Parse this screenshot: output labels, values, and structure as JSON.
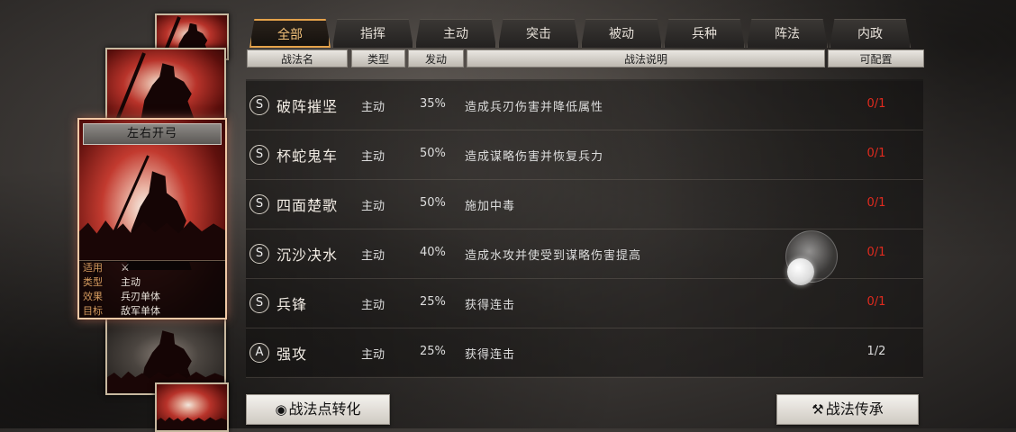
{
  "tabs": [
    {
      "label": "全部",
      "active": true
    },
    {
      "label": "指挥",
      "active": false
    },
    {
      "label": "主动",
      "active": false
    },
    {
      "label": "突击",
      "active": false
    },
    {
      "label": "被动",
      "active": false
    },
    {
      "label": "兵种",
      "active": false
    },
    {
      "label": "阵法",
      "active": false
    },
    {
      "label": "内政",
      "active": false
    }
  ],
  "table": {
    "headers": {
      "name": "战法名",
      "type": "类型",
      "rate": "发动",
      "desc": "战法说明",
      "config": "可配置"
    },
    "rows": [
      {
        "grade": "S",
        "name": "破阵摧坚",
        "type": "主动",
        "rate": "35%",
        "desc": "造成兵刃伤害并降低属性",
        "config": "0/1",
        "config_color": "#e02a1e"
      },
      {
        "grade": "S",
        "name": "杯蛇鬼车",
        "type": "主动",
        "rate": "50%",
        "desc": "造成谋略伤害并恢复兵力",
        "config": "0/1",
        "config_color": "#e02a1e"
      },
      {
        "grade": "S",
        "name": "四面楚歌",
        "type": "主动",
        "rate": "50%",
        "desc": "施加中毒",
        "config": "0/1",
        "config_color": "#e02a1e"
      },
      {
        "grade": "S",
        "name": "沉沙决水",
        "type": "主动",
        "rate": "40%",
        "desc": "造成水攻并使受到谋略伤害提高",
        "config": "0/1",
        "config_color": "#e02a1e"
      },
      {
        "grade": "S",
        "name": "兵锋",
        "type": "主动",
        "rate": "25%",
        "desc": "获得连击",
        "config": "0/1",
        "config_color": "#e02a1e"
      },
      {
        "grade": "A",
        "name": "强攻",
        "type": "主动",
        "rate": "25%",
        "desc": "获得连击",
        "config": "1/2",
        "config_color": "#dddddd"
      }
    ]
  },
  "card": {
    "title": "左右开弓",
    "info": [
      {
        "key": "适用",
        "value": "⚔"
      },
      {
        "key": "类型",
        "value": "主动"
      },
      {
        "key": "效果",
        "value": "兵刃单体"
      },
      {
        "key": "目标",
        "value": "敌军单体"
      }
    ]
  },
  "buttons": {
    "convert": "战法点转化",
    "convert_icon": "drop-icon",
    "inherit": "战法传承",
    "inherit_icon": "hammer-icon"
  },
  "colors": {
    "tab_active": "#e5a24a",
    "config_red": "#e02a1e"
  }
}
